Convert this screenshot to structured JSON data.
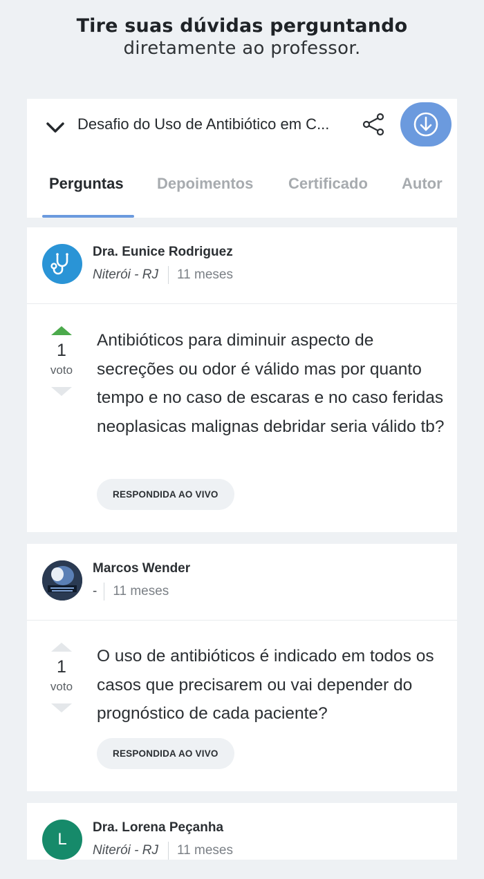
{
  "promo": {
    "line1": "Tire suas dúvidas perguntando",
    "line2": "diretamente ao professor."
  },
  "header": {
    "course_title": "Desafio do Uso de Antibiótico em C...",
    "accent_color": "#6b9ade",
    "tabs": [
      {
        "label": "Perguntas",
        "active": true
      },
      {
        "label": "Depoimentos",
        "active": false
      },
      {
        "label": "Certificado",
        "active": false
      },
      {
        "label": "Autor",
        "active": false
      }
    ]
  },
  "questions": [
    {
      "author": "Dra. Eunice Rodriguez",
      "location": "Niterói - RJ",
      "time": "11 meses",
      "avatar_icon": "stethoscope-icon",
      "votes": "1",
      "vote_label": "voto",
      "upvoted": true,
      "text": "Antibióticos para diminuir aspecto de secreções ou odor é válido mas por quanto tempo e no caso de escaras e no caso feridas neoplasicas malignas debridar seria válido tb?",
      "badge": "RESPONDIDA AO VIVO"
    },
    {
      "author": "Marcos Wender",
      "location": "-",
      "time": "11 meses",
      "avatar_icon": "photo-avatar",
      "votes": "1",
      "vote_label": "voto",
      "upvoted": false,
      "text": "O uso de antibióticos é indicado em todos os casos que precisarem ou vai depender do prognóstico de cada paciente?",
      "badge": "RESPONDIDA AO VIVO"
    },
    {
      "author": "Dra. Lorena Peçanha",
      "location": "Niterói - RJ",
      "time": "11 meses",
      "avatar_letter": "L",
      "avatar_color": "#168a6a"
    }
  ]
}
